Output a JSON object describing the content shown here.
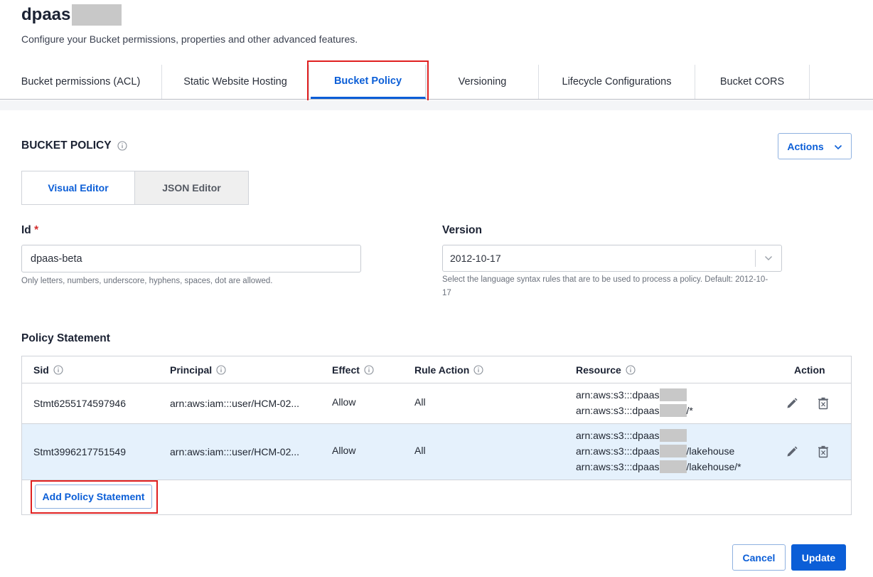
{
  "header": {
    "title": "dpaas",
    "subtitle": "Configure your Bucket permissions, properties and other advanced features."
  },
  "tabs": [
    {
      "label": "Bucket permissions (ACL)",
      "active": false
    },
    {
      "label": "Static Website Hosting",
      "active": false
    },
    {
      "label": "Bucket Policy",
      "active": true
    },
    {
      "label": "Versioning",
      "active": false
    },
    {
      "label": "Lifecycle Configurations",
      "active": false
    },
    {
      "label": "Bucket CORS",
      "active": false
    }
  ],
  "section": {
    "title": "BUCKET POLICY",
    "actions_label": "Actions"
  },
  "editor": {
    "visual_label": "Visual Editor",
    "json_label": "JSON Editor",
    "active": "visual"
  },
  "form": {
    "id_label": "Id",
    "id_required_mark": "*",
    "id_value": "dpaas-beta",
    "id_help": "Only letters, numbers, underscore, hyphens, spaces, dot are allowed.",
    "version_label": "Version",
    "version_value": "2012-10-17",
    "version_help_1": "Select the language syntax rules that are to be used to process a policy. Default: 2012-10-",
    "version_help_2": "17"
  },
  "policy_table": {
    "title": "Policy Statement",
    "columns": {
      "sid": "Sid",
      "principal": "Principal",
      "effect": "Effect",
      "rule_action": "Rule Action",
      "resource": "Resource",
      "action": "Action"
    },
    "rows": [
      {
        "sid": "Stmt6255174597946",
        "principal": "arn:aws:iam:::user/HCM-02...",
        "effect": "Allow",
        "rule_action": "All",
        "resources": [
          {
            "prefix": "arn:aws:s3:::dpaas",
            "suffix": ""
          },
          {
            "prefix": "arn:aws:s3:::dpaas",
            "suffix": "/*"
          }
        ]
      },
      {
        "sid": "Stmt3996217751549",
        "principal": "arn:aws:iam:::user/HCM-02...",
        "effect": "Allow",
        "rule_action": "All",
        "resources": [
          {
            "prefix": "arn:aws:s3:::dpaas",
            "suffix": ""
          },
          {
            "prefix": "arn:aws:s3:::dpaas",
            "suffix": "/lakehouse"
          },
          {
            "prefix": "arn:aws:s3:::dpaas",
            "suffix": "/lakehouse/*"
          }
        ]
      }
    ],
    "add_label": "Add Policy Statement"
  },
  "footer": {
    "cancel_label": "Cancel",
    "update_label": "Update"
  },
  "colors": {
    "accent": "#0b5ed7",
    "highlight": "#e02020",
    "row_selected": "#e5f1fc"
  }
}
